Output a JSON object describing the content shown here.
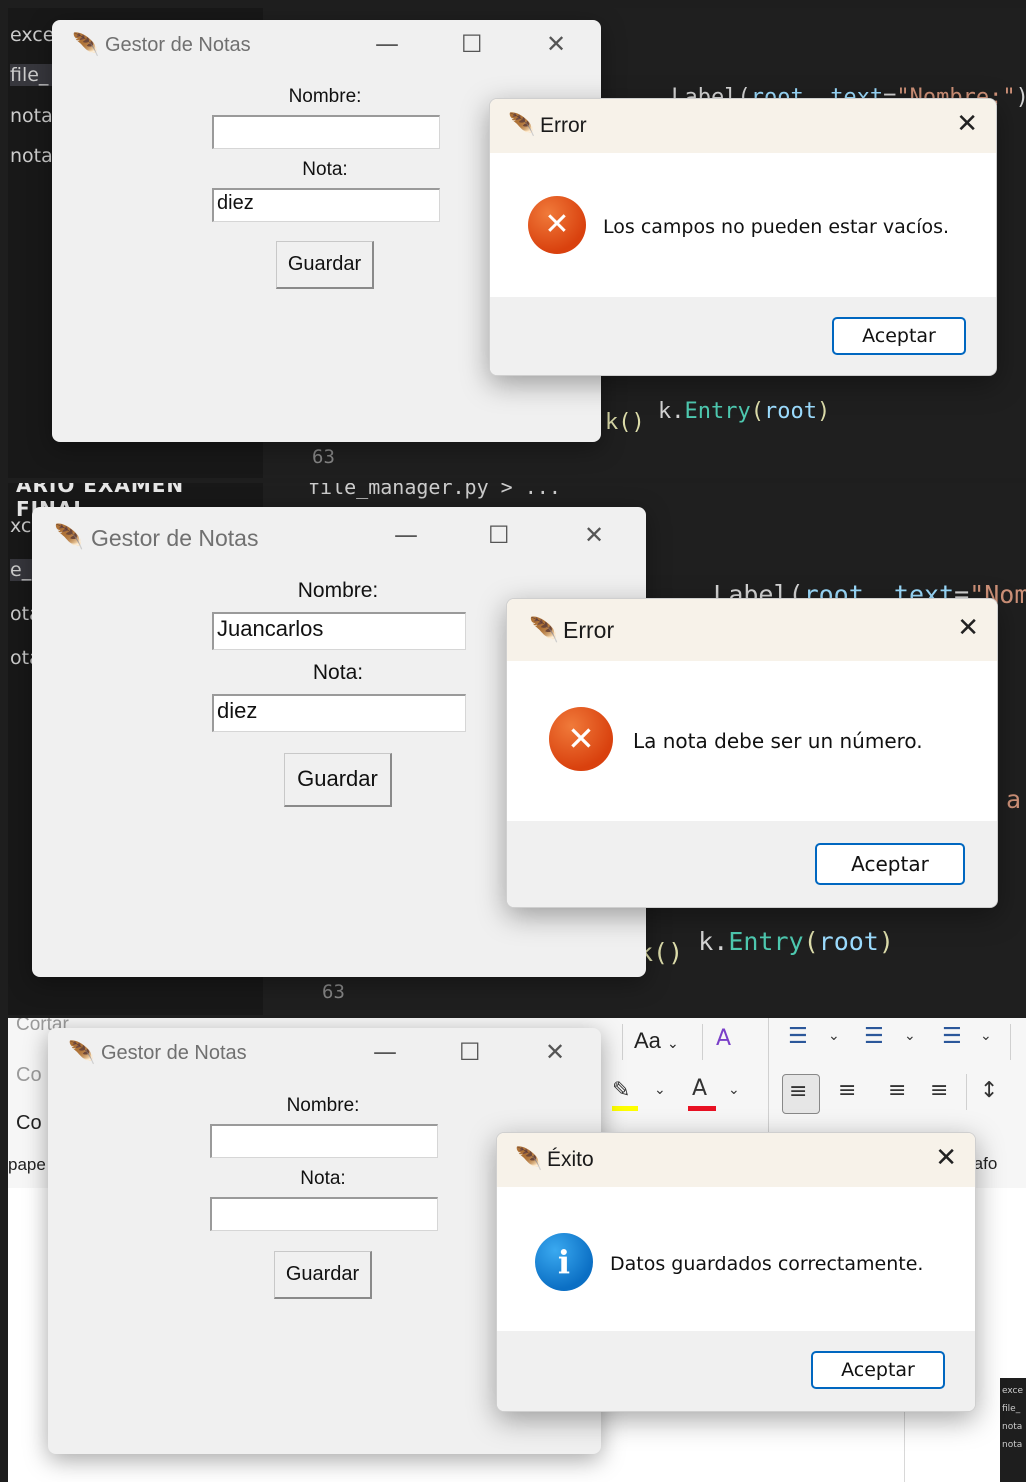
{
  "panel1": {
    "sidebar": [
      "exce",
      "file_",
      "nota",
      "nota"
    ],
    "code_line1": [
      ".Label(",
      "root",
      ", ",
      "text",
      "=",
      "\"Nombre:\"",
      ")"
    ],
    "code_line2": [
      "k.",
      "Entry",
      "(",
      "root",
      ")"
    ],
    "code_line3": [
      "k()"
    ],
    "gutter_number": "63",
    "tk_window": {
      "title": "Gestor de Notas",
      "nombre_label": "Nombre:",
      "nombre_value": "",
      "nota_label": "Nota:",
      "nota_value": "diez",
      "save_label": "Guardar"
    },
    "dialog": {
      "title": "Error",
      "message": "Los campos no pueden estar vacíos.",
      "ok_label": "Aceptar",
      "icon": "error-icon"
    }
  },
  "panel2": {
    "header_cut": "ARIO EXAMEN FINAL",
    "tab_cut": "file_manager.py > ...",
    "sidebar": [
      "xce",
      "e_",
      "ota",
      "ota"
    ],
    "code_line1": [
      ".Label(",
      "root",
      ", ",
      "text",
      "=",
      "\"Nombre"
    ],
    "code_line2": [
      "k.",
      "Entry",
      "(",
      "root",
      ")"
    ],
    "code_line3": [
      "k()"
    ],
    "code_right_fragment": "a",
    "gutter_number": "63",
    "tk_window": {
      "title": "Gestor de Notas",
      "nombre_label": "Nombre:",
      "nombre_value": "Juancarlos",
      "nota_label": "Nota:",
      "nota_value": "diez",
      "save_label": "Guardar"
    },
    "dialog": {
      "title": "Error",
      "message": "La nota debe ser un número.",
      "ok_label": "Aceptar",
      "icon": "error-icon"
    }
  },
  "panel3": {
    "ribbon_left": [
      "Cortar",
      "Co",
      "Co",
      "pape"
    ],
    "ribbon_font_case": "Aa",
    "ribbon_paragraph": "rafo",
    "tk_window": {
      "title": "Gestor de Notas",
      "nombre_label": "Nombre:",
      "nombre_value": "",
      "nota_label": "Nota:",
      "nota_value": "",
      "save_label": "Guardar"
    },
    "dialog": {
      "title": "Éxito",
      "message": "Datos guardados correctamente.",
      "ok_label": "Aceptar",
      "icon": "info-icon"
    },
    "thumbnail_items": [
      "exce",
      "file_",
      "nota",
      "nota"
    ]
  },
  "colors": {
    "error": "#d9410e",
    "info": "#0b6fc4",
    "accent_button_border": "#0067c0",
    "highlight_yellow": "#ffff00",
    "font_red": "#e81123"
  }
}
